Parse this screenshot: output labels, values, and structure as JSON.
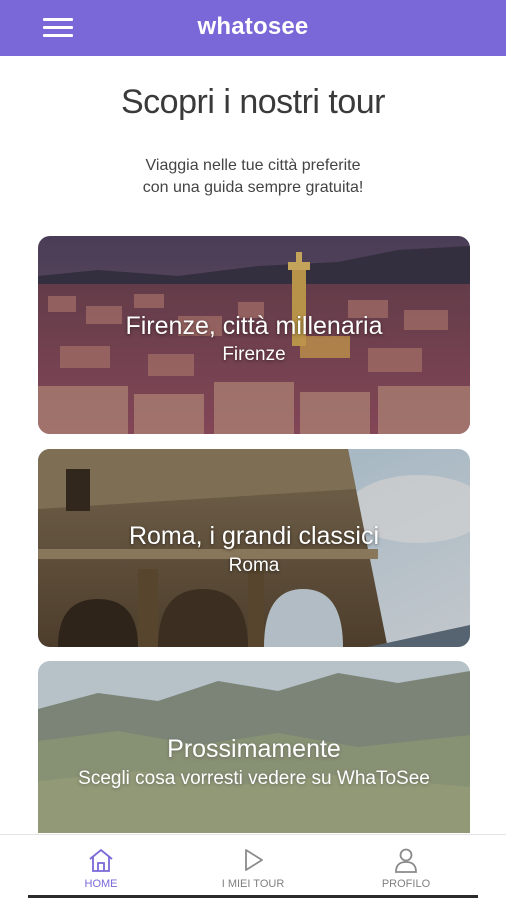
{
  "header": {
    "brand": "whatosee",
    "menu_icon": "hamburger-menu-icon",
    "color": "#7a68d8"
  },
  "main": {
    "title": "Scopri i nostri tour",
    "subtitle_line1": "Viaggia nelle tue città preferite",
    "subtitle_line2": "con una guida sempre gratuita!"
  },
  "tours": [
    {
      "title": "Firenze, città millenaria",
      "city": "Firenze"
    },
    {
      "title": "Roma, i grandi classici",
      "city": "Roma"
    },
    {
      "title": "Prossimamente",
      "city": "Scegli cosa vorresti vedere su WhaToSee"
    }
  ],
  "bottom_nav": {
    "items": [
      {
        "label": "HOME",
        "icon": "home-icon",
        "active": true
      },
      {
        "label": "I MIEI TOUR",
        "icon": "play-icon",
        "active": false
      },
      {
        "label": "PROFILO",
        "icon": "user-icon",
        "active": false
      }
    ],
    "active_color": "#7a68d8"
  }
}
